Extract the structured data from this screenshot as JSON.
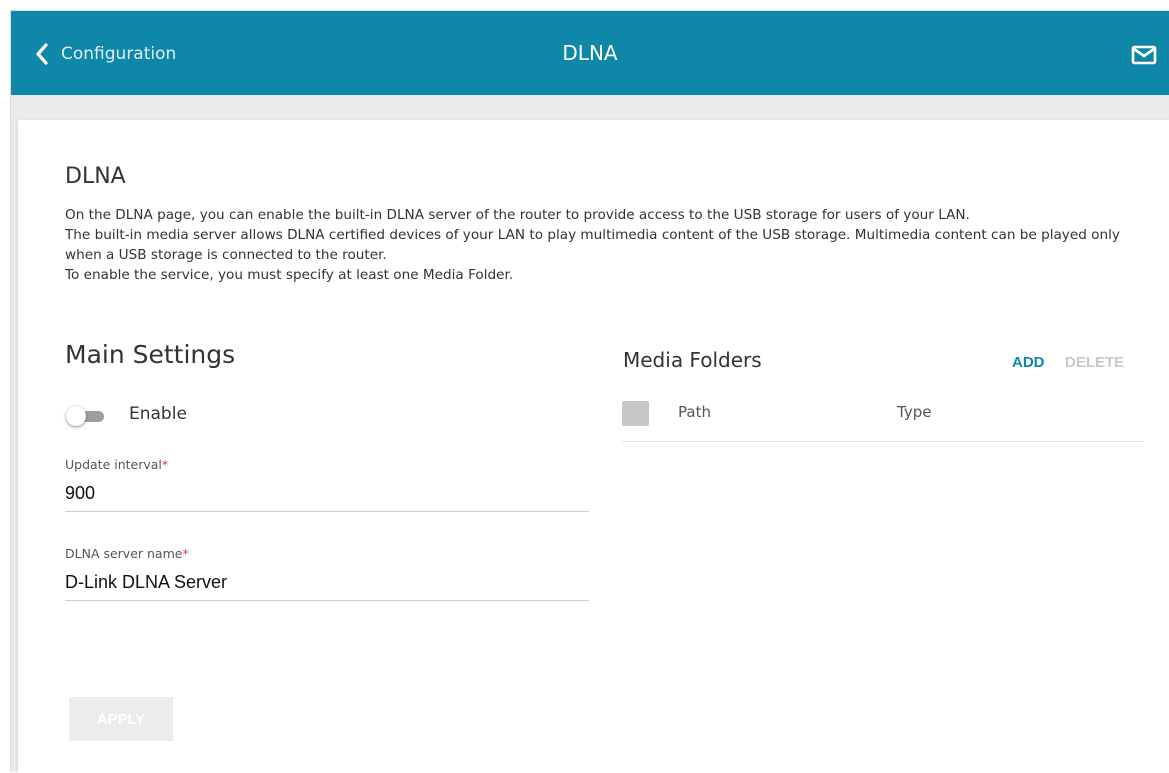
{
  "header": {
    "back_label": "Configuration",
    "title": "DLNA",
    "back_icon": "chevron-left-icon",
    "mail_icon": "envelope-icon",
    "bar_color": "#0f87a8"
  },
  "section": {
    "title": "DLNA",
    "description": [
      "On the DLNA page, you can enable the built-in DLNA server of the router to provide access to the USB storage for users of your LAN.",
      "The built-in media server allows DLNA certified devices of your LAN to play multimedia content of the USB storage. Multimedia content can be played only when a USB storage is connected to the router.",
      "To enable the service, you must specify at least one Media Folder."
    ]
  },
  "main_settings": {
    "title": "Main Settings",
    "enable_label": "Enable",
    "enable_state": false,
    "update_interval": {
      "label": "Update interval",
      "required_mark": "*",
      "value": "900"
    },
    "server_name": {
      "label": "DLNA server name",
      "required_mark": "*",
      "value": "D-Link DLNA Server"
    },
    "apply_label": "APPLY"
  },
  "media_folders": {
    "title": "Media Folders",
    "add_label": "ADD",
    "delete_label": "DELETE",
    "columns": [
      "Path",
      "Type"
    ],
    "rows": []
  }
}
